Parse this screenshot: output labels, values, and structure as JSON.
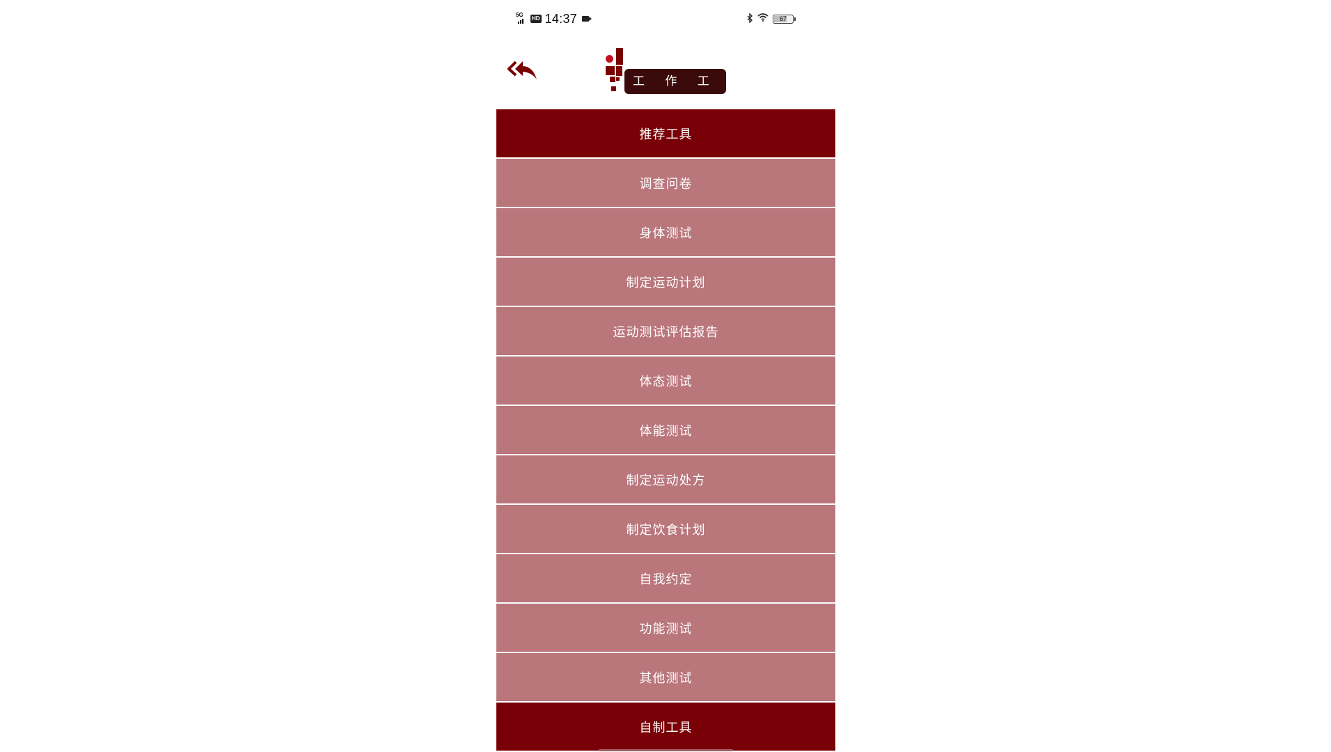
{
  "status_bar": {
    "network": "5G",
    "hd": "HD",
    "time": "14:37",
    "battery": "67",
    "icons": [
      "signal-icon",
      "hd-icon",
      "video-record-icon",
      "bluetooth-icon",
      "wifi-icon",
      "battery-icon"
    ]
  },
  "header": {
    "title": "工 作 工 具",
    "back_icon": "double-back-arrow-icon"
  },
  "colors": {
    "primary": "#790006",
    "secondary": "#b9767b",
    "title_bg": "#3b0a0a"
  },
  "menu": {
    "items": [
      {
        "label": "推荐工具",
        "style": "primary"
      },
      {
        "label": "调查问卷",
        "style": "secondary"
      },
      {
        "label": "身体测试",
        "style": "secondary"
      },
      {
        "label": "制定运动计划",
        "style": "secondary"
      },
      {
        "label": "运动测试评估报告",
        "style": "secondary"
      },
      {
        "label": "体态测试",
        "style": "secondary"
      },
      {
        "label": "体能测试",
        "style": "secondary"
      },
      {
        "label": "制定运动处方",
        "style": "secondary"
      },
      {
        "label": "制定饮食计划",
        "style": "secondary"
      },
      {
        "label": "自我约定",
        "style": "secondary"
      },
      {
        "label": "功能测试",
        "style": "secondary"
      },
      {
        "label": "其他测试",
        "style": "secondary"
      },
      {
        "label": "自制工具",
        "style": "primary"
      }
    ]
  }
}
